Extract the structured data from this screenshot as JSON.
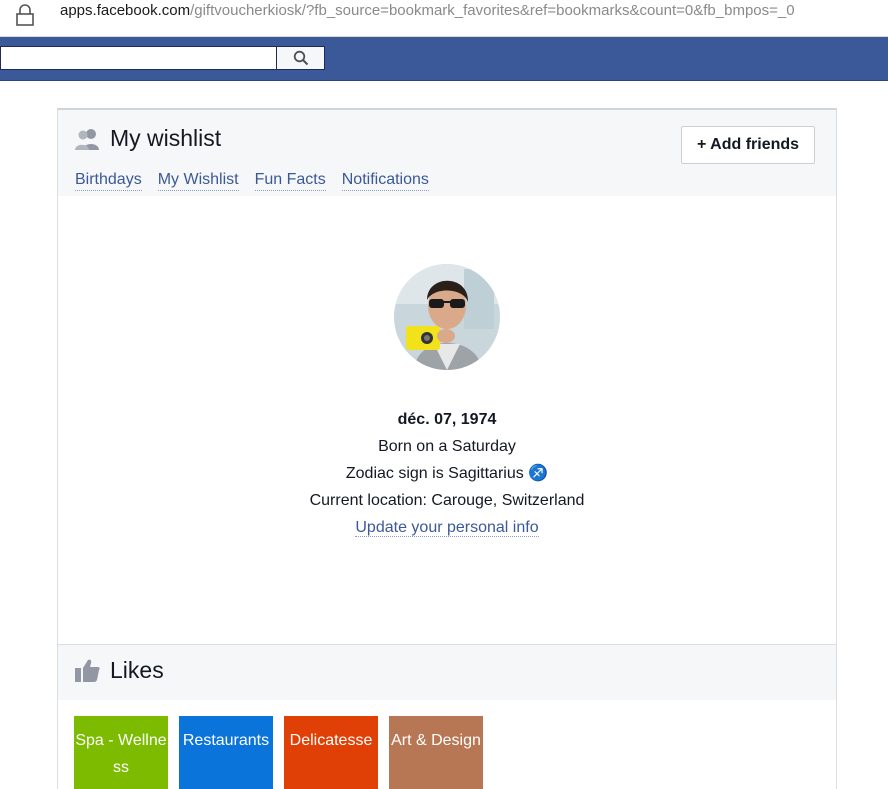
{
  "browser": {
    "url_host": "apps.facebook.com",
    "url_path": "/giftvoucherkiosk/?fb_source=bookmark_favorites&ref=bookmarks&count=0&fb_bmpos=_0"
  },
  "fbbar": {
    "search_placeholder": ""
  },
  "wishlist": {
    "title": "My wishlist",
    "add_friends_label": "+ Add friends",
    "tabs": [
      {
        "label": "Birthdays"
      },
      {
        "label": "My Wishlist"
      },
      {
        "label": "Fun Facts"
      },
      {
        "label": "Notifications"
      }
    ]
  },
  "profile": {
    "birthday": "déc. 07, 1974",
    "born_on": "Born on a Saturday",
    "zodiac": "Zodiac sign is Sagittarius",
    "zodiac_symbol": "♐",
    "location": "Current location: Carouge, Switzerland",
    "update_link": "Update your personal info"
  },
  "likes": {
    "title": "Likes",
    "tiles": [
      {
        "label": "Spa - Wellness",
        "color": "#7cbb00"
      },
      {
        "label": "Restaurants",
        "color": "#0a74da"
      },
      {
        "label": "Delicatesse",
        "color": "#e04006"
      },
      {
        "label": "Art & Design",
        "color": "#b87754"
      }
    ]
  },
  "colors": {
    "fb_blue": "#3b5998",
    "link": "#3b5998"
  }
}
